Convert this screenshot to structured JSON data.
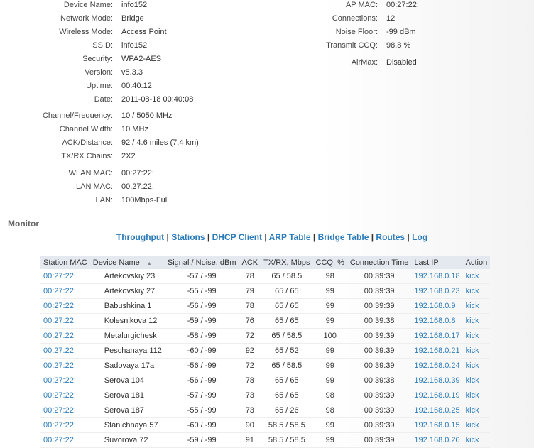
{
  "info_left": [
    {
      "k": "Device Name:",
      "v": "info152"
    },
    {
      "k": "Network Mode:",
      "v": "Bridge"
    },
    {
      "k": "Wireless Mode:",
      "v": "Access Point"
    },
    {
      "k": "SSID:",
      "v": "info152"
    },
    {
      "k": "Security:",
      "v": "WPA2-AES"
    },
    {
      "k": "Version:",
      "v": "v5.3.3"
    },
    {
      "k": "Uptime:",
      "v": "00:40:12"
    },
    {
      "k": "Date:",
      "v": "2011-08-18 00:40:08"
    },
    {
      "k": "Channel/Frequency:",
      "v": "10 / 5050 MHz"
    },
    {
      "k": "Channel Width:",
      "v": "10 MHz"
    },
    {
      "k": "ACK/Distance:",
      "v": "92 / 4.6 miles (7.4 km)"
    },
    {
      "k": "TX/RX Chains:",
      "v": "2X2"
    },
    {
      "k": "WLAN MAC:",
      "v": "00:27:22:"
    },
    {
      "k": "LAN MAC:",
      "v": "00:27:22:"
    },
    {
      "k": "LAN:",
      "v": "100Mbps-Full"
    }
  ],
  "info_right": [
    {
      "k": "AP MAC:",
      "v": "00:27:22:"
    },
    {
      "k": "Connections:",
      "v": "12"
    },
    {
      "k": "Noise Floor:",
      "v": "-99 dBm"
    },
    {
      "k": "Transmit CCQ:",
      "v": "98.8 %"
    },
    {
      "k": "AirMax:",
      "v": "Disabled"
    }
  ],
  "monitor": {
    "title": "Monitor",
    "tabs": [
      "Throughput",
      "Stations",
      "DHCP Client",
      "ARP Table",
      "Bridge Table",
      "Routes",
      "Log"
    ],
    "active": "Stations"
  },
  "table": {
    "headers": [
      "Station MAC",
      "Device Name",
      "Signal / Noise, dBm",
      "ACK",
      "TX/RX, Mbps",
      "CCQ, %",
      "Connection Time",
      "Last IP",
      "Action"
    ],
    "sort_indicator": "▲",
    "rows": [
      [
        "00:27:22:",
        "Artekovskiy 23",
        "-57 / -99",
        "78",
        "65 / 58.5",
        "98",
        "00:39:39",
        "192.168.0.18",
        "kick"
      ],
      [
        "00:27:22:",
        "Artekovskiy 27",
        "-55 / -99",
        "79",
        "65 / 65",
        "99",
        "00:39:39",
        "192.168.0.23",
        "kick"
      ],
      [
        "00:27:22:",
        "Babushkina 1",
        "-56 / -99",
        "78",
        "65 / 65",
        "99",
        "00:39:39",
        "192.168.0.9",
        "kick"
      ],
      [
        "00:27:22:",
        "Kolesnikova 12",
        "-59 / -99",
        "76",
        "65 / 65",
        "99",
        "00:39:38",
        "192.168.0.8",
        "kick"
      ],
      [
        "00:27:22:",
        "Metalurgichesk",
        "-58 / -99",
        "72",
        "65 / 58.5",
        "100",
        "00:39:39",
        "192.168.0.17",
        "kick"
      ],
      [
        "00:27:22:",
        "Peschanaya 112",
        "-60 / -99",
        "92",
        "65 / 52",
        "99",
        "00:39:39",
        "192.168.0.21",
        "kick"
      ],
      [
        "00:27:22:",
        "Sadovaya 17a",
        "-56 / -99",
        "72",
        "65 / 58.5",
        "99",
        "00:39:39",
        "192.168.0.24",
        "kick"
      ],
      [
        "00:27:22:",
        "Serova 104",
        "-56 / -99",
        "78",
        "65 / 65",
        "99",
        "00:39:38",
        "192.168.0.39",
        "kick"
      ],
      [
        "00:27:22:",
        "Serova 181",
        "-57 / -99",
        "73",
        "65 / 65",
        "98",
        "00:39:39",
        "192.168.0.19",
        "kick"
      ],
      [
        "00:27:22:",
        "Serova 187",
        "-55 / -99",
        "73",
        "65 / 26",
        "98",
        "00:39:39",
        "192.168.0.25",
        "kick"
      ],
      [
        "00:27:22:",
        "Stanichnaya 57",
        "-60 / -99",
        "90",
        "58.5 / 58.5",
        "99",
        "00:39:39",
        "192.168.0.15",
        "kick"
      ],
      [
        "00:27:22:",
        "Suvorova 72",
        "-59 / -99",
        "91",
        "58.5 / 58.5",
        "99",
        "00:39:39",
        "192.168.0.20",
        "kick"
      ]
    ]
  }
}
